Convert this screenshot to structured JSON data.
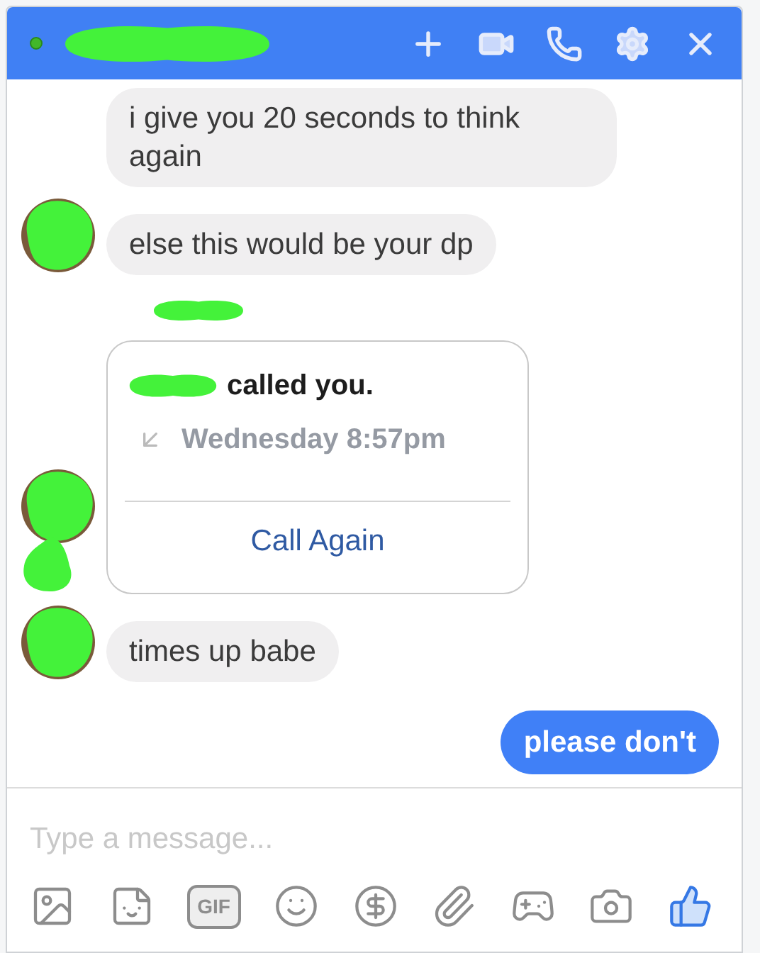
{
  "header": {
    "online": true,
    "actions": [
      {
        "kind": "add"
      },
      {
        "kind": "video"
      },
      {
        "kind": "phone"
      },
      {
        "kind": "settings"
      },
      {
        "kind": "close"
      }
    ]
  },
  "messages": [
    {
      "kind": "received",
      "avatar": false,
      "text": "i give you 20 seconds to think again"
    },
    {
      "kind": "received",
      "avatar": true,
      "text": "else this would be your dp"
    },
    {
      "kind": "redacted_name"
    },
    {
      "kind": "call",
      "avatar": true,
      "title": "called you.",
      "time": "Wednesday 8:57pm",
      "action": "Call Again"
    },
    {
      "kind": "received",
      "avatar": true,
      "text": "times up babe"
    },
    {
      "kind": "sent",
      "text": "please don't"
    }
  ],
  "composer": {
    "placeholder": "Type a message...",
    "tools": [
      {
        "kind": "photo"
      },
      {
        "kind": "sticker"
      },
      {
        "kind": "gif",
        "label": "GIF"
      },
      {
        "kind": "emoji"
      },
      {
        "kind": "payment"
      },
      {
        "kind": "attach"
      },
      {
        "kind": "game"
      },
      {
        "kind": "camera"
      },
      {
        "kind": "like"
      }
    ]
  }
}
